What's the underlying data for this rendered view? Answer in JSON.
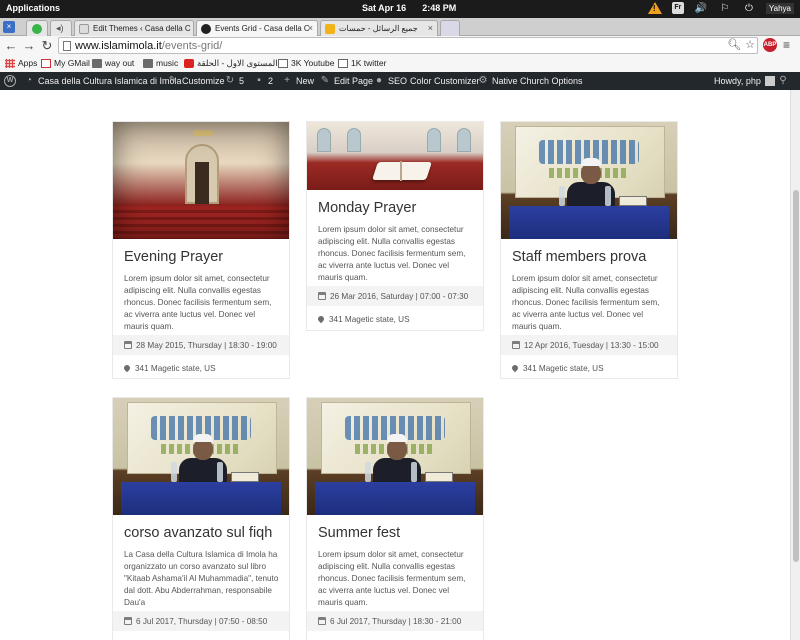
{
  "os": {
    "apps_label": "Applications",
    "date": "Sat Apr 16",
    "time": "2:48 PM",
    "user": "Yahya",
    "keyboard_layout": "Fr"
  },
  "tabs": [
    {
      "label": "Edit Themes ‹ Casa della C",
      "active": false
    },
    {
      "label": "Events Grid - Casa della C",
      "active": true
    },
    {
      "label": "جميع الرسائل - حمسات",
      "active": false
    }
  ],
  "address": {
    "domain": "www.islamimola.it",
    "path": "/events-grid/",
    "abp_label": "ABP"
  },
  "bookmarks": [
    {
      "label": "Apps",
      "icon": "apps-icon"
    },
    {
      "label": "My GMail",
      "icon": "gmail-icon"
    },
    {
      "label": "way out",
      "icon": "folder-icon"
    },
    {
      "label": "music",
      "icon": "folder-icon"
    },
    {
      "label": "المستوى الاول - الحلقة",
      "icon": "youtube-icon"
    },
    {
      "label": "3K Youtube",
      "icon": "document-icon"
    },
    {
      "label": "1K twitter",
      "icon": "document-icon"
    }
  ],
  "admin_bar": {
    "site_name": "Casa della Cultura Islamica di Imola",
    "customize": "Customize",
    "updates_count": "5",
    "comments_count": "2",
    "new_label": "New",
    "edit_page": "Edit Page",
    "seo": "SEO",
    "color_customizer": "Color Customizer",
    "native_church": "Native Church Options",
    "howdy": "Howdy, php"
  },
  "events": [
    {
      "title": "Evening Prayer",
      "description": "Lorem ipsum dolor sit amet, consectetur adipiscing elit. Nulla convallis egestas rhoncus. Donec facilisis fermentum sem, ac viverra ante luctus vel. Donec vel mauris quam.",
      "date": "28 May 2015, Thursday | 18:30 - 19:00",
      "location": "341 Magetic state, US",
      "image": "mosque-interior"
    },
    {
      "title": "Monday Prayer",
      "description": "Lorem ipsum dolor sit amet, consectetur adipiscing elit. Nulla convallis egestas rhoncus. Donec facilisis fermentum sem, ac viverra ante luctus vel. Donec vel mauris quam.",
      "date": "26 Mar 2016, Saturday | 07:00 - 07:30",
      "location": "341 Magetic state, US",
      "image": "quran-on-stand"
    },
    {
      "title": "Staff members prova",
      "description": "Lorem ipsum dolor sit amet, consectetur adipiscing elit. Nulla convallis egestas rhoncus. Donec facilisis fermentum sem, ac viverra ante luctus vel. Donec vel mauris quam.",
      "date": "12 Apr 2016, Tuesday | 13:30 - 15:00",
      "location": "341 Magetic state, US",
      "image": "lecture"
    },
    {
      "title": "corso avanzato sul fiqh",
      "description": "La Casa della Cultura Islamica di Imola ha organizzato un corso avanzato sul libro \"Kitaab Ashama'il Al Muhammadia\", tenuto dal dott. Abu Abderrahman, responsabile Dau'a",
      "date": "6 Jul 2017, Thursday | 07:50 - 08:50",
      "image": "lecture"
    },
    {
      "title": "Summer fest",
      "description": "Lorem ipsum dolor sit amet, consectetur adipiscing elit. Nulla convallis egestas rhoncus. Donec facilisis fermentum sem, ac viverra ante luctus vel. Donec vel mauris quam.",
      "date": "6 Jul 2017, Thursday | 18:30 - 21:00",
      "image": "lecture"
    }
  ],
  "colors": {
    "admin_bar_bg": "#23282d",
    "date_bar_bg": "#f3f3f3",
    "title_text": "#333333"
  }
}
